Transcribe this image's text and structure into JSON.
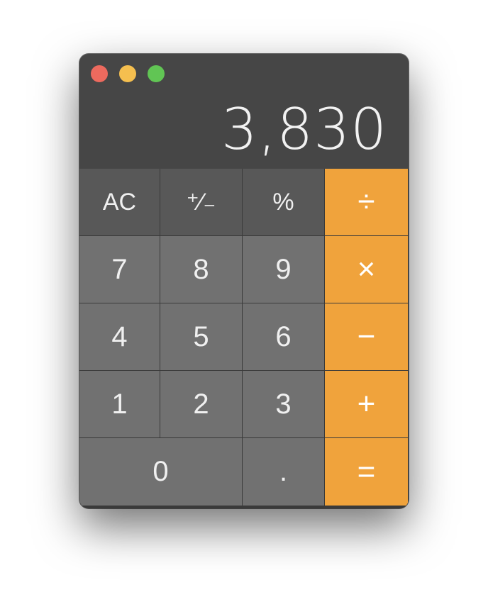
{
  "window": {
    "traffic_lights": {
      "close": "#ed6a5e",
      "minimize": "#f5bf4f",
      "zoom": "#61c554"
    }
  },
  "display": {
    "value": "3,830"
  },
  "keys": {
    "ac": "AC",
    "plus_minus": "⁺∕₋",
    "percent": "%",
    "divide": "÷",
    "seven": "7",
    "eight": "8",
    "nine": "9",
    "multiply": "×",
    "four": "4",
    "five": "5",
    "six": "6",
    "minus": "−",
    "one": "1",
    "two": "2",
    "three": "3",
    "plus": "+",
    "zero": "0",
    "decimal": ".",
    "equals": "="
  },
  "colors": {
    "window_bg": "#464646",
    "function_key": "#585858",
    "number_key": "#717171",
    "operator_key": "#f0a33c"
  }
}
